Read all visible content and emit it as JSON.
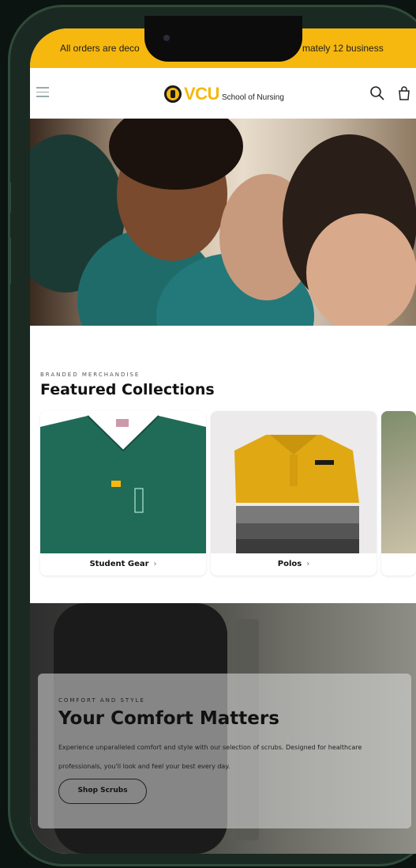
{
  "announcement": {
    "left": "All orders are deco",
    "right": "mately 12 business"
  },
  "header": {
    "logo_text": "VCU",
    "logo_sub": "School of Nursing"
  },
  "featured": {
    "kicker": "BRANDED MERCHANDISE",
    "title": "Featured Collections",
    "cards": [
      {
        "label": "Student Gear",
        "chevron": "›"
      },
      {
        "label": "Polos",
        "chevron": "›"
      }
    ]
  },
  "promo": {
    "kicker": "COMFORT AND STYLE",
    "title": "Your Comfort Matters",
    "description": "Experience unparalleled comfort and style with our selection of scrubs. Designed for healthcare professionals, you'll look and feel your best every day.",
    "button": "Shop Scrubs"
  },
  "colors": {
    "accent": "#f6b80f",
    "scrub_green": "#1f6b57",
    "polo_gold": "#e0a812"
  }
}
